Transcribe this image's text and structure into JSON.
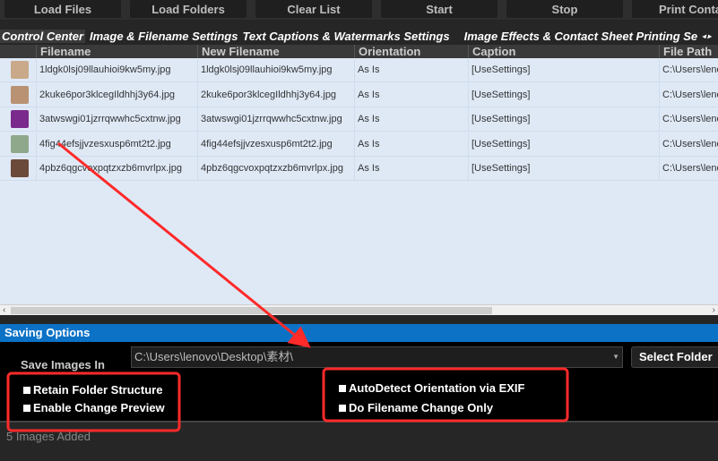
{
  "toolbar": {
    "buttons": [
      "Load Files",
      "Load Folders",
      "Clear List",
      "Start",
      "Stop",
      "Print Conta"
    ]
  },
  "tabs": [
    "Control Center",
    "Image & Filename Settings",
    "Text Captions & Watermarks Settings",
    "Image Effects & Contact Sheet Printing Se"
  ],
  "columns": [
    "Filename",
    "New Filename",
    "Orientation",
    "Caption",
    "File Path"
  ],
  "rows": [
    {
      "filename": "1ldgk0lsj09llauhioi9kw5my.jpg",
      "new_filename": "1ldgk0lsj09llauhioi9kw5my.jpg",
      "orientation": "As Is",
      "caption": "[UseSettings]",
      "path": "C:\\Users\\lenovo"
    },
    {
      "filename": "2kuke6por3klcegIldhhj3y64.jpg",
      "new_filename": "2kuke6por3klcegIldhhj3y64.jpg",
      "orientation": "As Is",
      "caption": "[UseSettings]",
      "path": "C:\\Users\\lenovo"
    },
    {
      "filename": "3atwswgi01jzrrqwwhc5cxtnw.jpg",
      "new_filename": "3atwswgi01jzrrqwwhc5cxtnw.jpg",
      "orientation": "As Is",
      "caption": "[UseSettings]",
      "path": "C:\\Users\\lenovo"
    },
    {
      "filename": "4fig44efsjjvzesxusp6mt2t2.jpg",
      "new_filename": "4fig44efsjjvzesxusp6mt2t2.jpg",
      "orientation": "As Is",
      "caption": "[UseSettings]",
      "path": "C:\\Users\\lenovo"
    },
    {
      "filename": "4pbz6qgcvoxpqtzxzb6mvrlpx.jpg",
      "new_filename": "4pbz6qgcvoxpqtzxzb6mvrlpx.jpg",
      "orientation": "As Is",
      "caption": "[UseSettings]",
      "path": "C:\\Users\\lenovo"
    }
  ],
  "saving": {
    "title": "Saving Options",
    "save_in_label": "Save Images In",
    "path": "C:\\Users\\lenovo\\Desktop\\素材\\",
    "select_folder": "Select Folder",
    "options_left": [
      "Retain Folder Structure",
      "Enable Change Preview"
    ],
    "options_right": [
      "AutoDetect Orientation via EXIF",
      "Do Filename Change Only"
    ]
  },
  "status": "5 Images Added",
  "colors": {
    "accent": "#0b72c6",
    "annotation": "#ff2a2a"
  }
}
